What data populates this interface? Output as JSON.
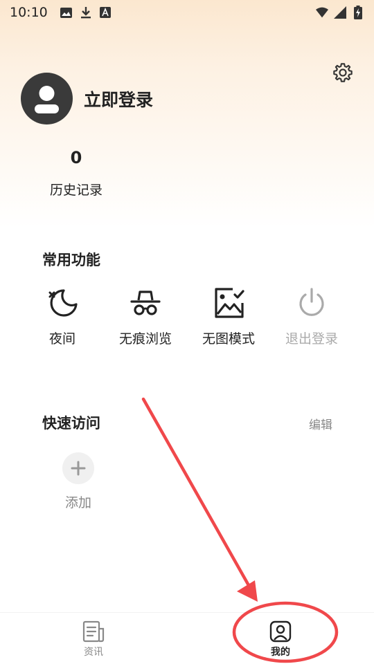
{
  "status_bar": {
    "time": "10:10",
    "left_icons": [
      "image-icon",
      "download-icon",
      "font-icon"
    ],
    "right_icons": [
      "wifi-icon",
      "signal-icon",
      "battery-charging-icon"
    ]
  },
  "header": {
    "settings_icon": "gear-icon"
  },
  "profile": {
    "login_label": "立即登录",
    "avatar_icon": "user-avatar-icon"
  },
  "history": {
    "count": "0",
    "label": "历史记录"
  },
  "common_functions": {
    "title": "常用功能",
    "items": [
      {
        "label": "夜间",
        "icon": "moon-icon",
        "enabled": true
      },
      {
        "label": "无痕浏览",
        "icon": "incognito-icon",
        "enabled": true
      },
      {
        "label": "无图模式",
        "icon": "no-image-icon",
        "enabled": true
      },
      {
        "label": "退出登录",
        "icon": "power-icon",
        "enabled": false
      }
    ]
  },
  "quick_access": {
    "title": "快速访问",
    "edit_label": "编辑",
    "add_label": "添加"
  },
  "tabbar": {
    "tabs": [
      {
        "label": "资讯",
        "icon": "news-icon",
        "active": false
      },
      {
        "label": "我的",
        "icon": "profile-icon",
        "active": true
      }
    ]
  },
  "colors": {
    "annotation": "#f0484b",
    "gradient_top": "#fbe7cf",
    "disabled": "#aaaaaa"
  }
}
